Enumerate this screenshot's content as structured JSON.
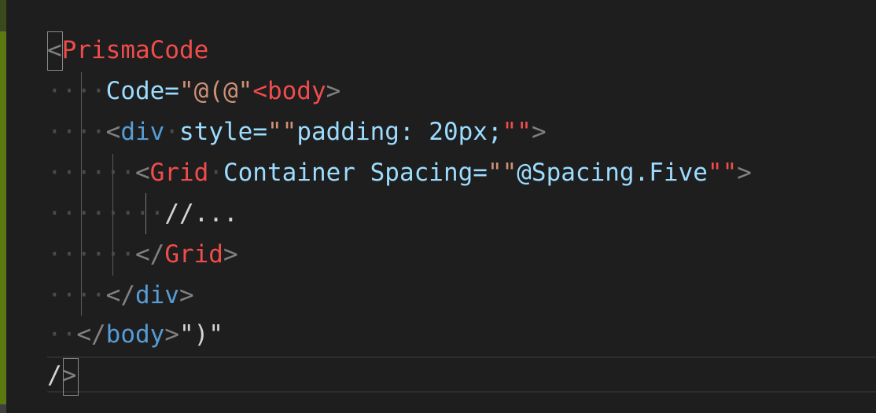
{
  "editor": {
    "line1": {
      "open": "<",
      "tag": "PrismaCode"
    },
    "line2": {
      "attr": "Code=",
      "q": "\"",
      "str": "@(@\"",
      "open": "<",
      "tag": "body",
      "close": ">"
    },
    "line3": {
      "open": "<",
      "tag": "div",
      "attr": "style=",
      "q1": "\"\"",
      "val": "padding: 20px;",
      "q2": "\"\"",
      "close": ">"
    },
    "line4": {
      "open": "<",
      "tag": "Grid",
      "attr": "Container Spacing=",
      "q1": "\"\"",
      "val": "@Spacing.Five",
      "q2": "\"\"",
      "close": ">"
    },
    "line5": {
      "text": "//..."
    },
    "line6": {
      "open": "</",
      "tag": "Grid",
      "close": ">"
    },
    "line7": {
      "open": "</",
      "tag": "div",
      "close": ">"
    },
    "line8": {
      "open": "</",
      "tag": "body",
      "close": ">",
      "tail": "\")\""
    },
    "line9": {
      "slash": "/",
      "close": ">"
    }
  },
  "colors": {
    "background": "#1e1e1e",
    "component_tag": "#f14c4c",
    "html_tag": "#569cd6",
    "attribute": "#9cdcfe",
    "string": "#ce9178",
    "punctuation": "#808080",
    "gutter_modified": "#5a7a10"
  }
}
